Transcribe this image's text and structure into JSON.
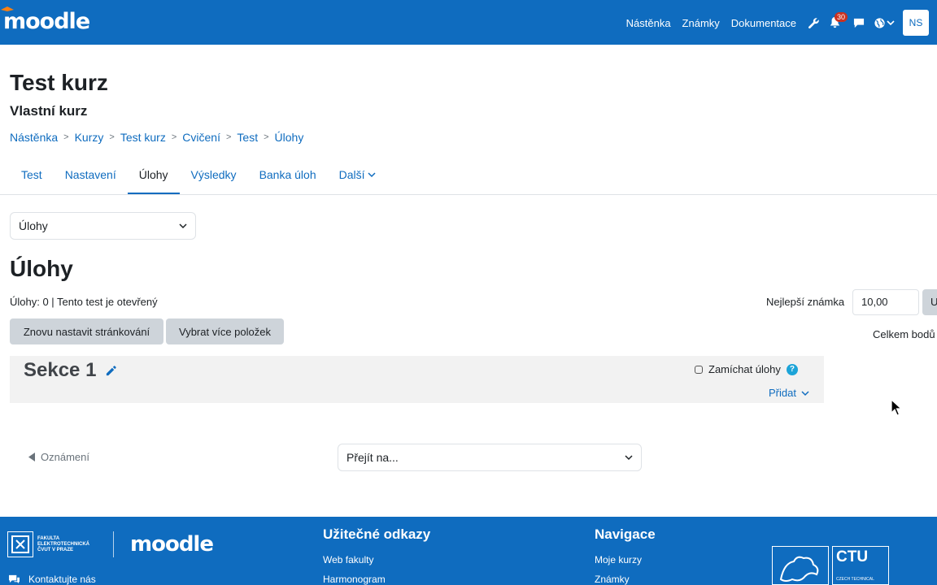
{
  "navbar": {
    "logo_text": "moodle",
    "links": [
      "Nástěnka",
      "Známky",
      "Dokumentace"
    ],
    "notification_count": "30",
    "avatar_initials": "NS",
    "brand_color": "#0f6cbf"
  },
  "header": {
    "title": "Test kurz",
    "subtitle": "Vlastní kurz",
    "breadcrumb": [
      "Nástěnka",
      "Kurzy",
      "Test kurz",
      "Cvičení",
      "Test",
      "Úlohy"
    ]
  },
  "tabs": {
    "items": [
      "Test",
      "Nastavení",
      "Úlohy",
      "Výsledky",
      "Banka úloh",
      "Další"
    ],
    "active": "Úlohy"
  },
  "main": {
    "select_value": "Úlohy",
    "heading": "Úlohy",
    "status": "Úlohy: 0 | Tento test je otevřený",
    "grade_label": "Nejlepší známka",
    "grade_value": "10,00",
    "grade_button_partial": "U",
    "repaginate_button": "Znovu nastavit stránkování",
    "select_multiple_button": "Vybrat více položek",
    "total_label": "Celkem bodů"
  },
  "section": {
    "title": "Sekce 1",
    "shuffle_label": "Zamíchat úlohy",
    "add_label": "Přidat"
  },
  "bottom_nav": {
    "prev_label": "Oznámení",
    "jump_placeholder": "Přejít na..."
  },
  "footer": {
    "fel_text": "FAKULTA ELEKTROTECHNICKÁ ČVUT V PRAZE",
    "moodle_text": "moodle",
    "contact": "Kontaktujte nás",
    "col1_title": "Užitečné odkazy",
    "col1_links": [
      "Web fakulty",
      "Harmonogram"
    ],
    "col2_title": "Navigace",
    "col2_links": [
      "Moje kurzy",
      "Známky"
    ],
    "ctu_title": "CTU",
    "ctu_sub": "CZECH TECHNICAL"
  }
}
